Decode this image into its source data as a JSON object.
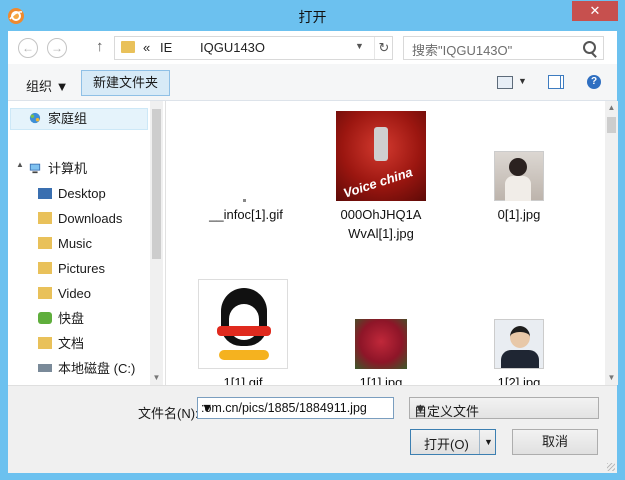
{
  "window": {
    "title": "打开",
    "close_glyph": "✕"
  },
  "nav": {
    "back_glyph": "←",
    "forward_glyph": "→",
    "up_glyph": "↑",
    "address_segments": [
      "«",
      "IE",
      "IQGU143O"
    ],
    "address_dropdown_glyph": "▼",
    "refresh_glyph": "↻",
    "search_placeholder": "搜索\"IQGU143O\""
  },
  "toolbar": {
    "organize_label": "组织 ▼",
    "new_folder_label": "新建文件夹",
    "views_dropdown_glyph": "▼",
    "help_glyph": "?"
  },
  "sidebar": {
    "items": [
      {
        "label": "家庭组",
        "icon": "homegroup-icon"
      },
      {
        "label": "计算机",
        "icon": "computer-icon"
      },
      {
        "label": "Desktop",
        "icon": "folder-icon"
      },
      {
        "label": "Downloads",
        "icon": "folder-icon"
      },
      {
        "label": "Music",
        "icon": "folder-icon"
      },
      {
        "label": "Pictures",
        "icon": "folder-icon"
      },
      {
        "label": "Video",
        "icon": "folder-icon"
      },
      {
        "label": "快盘",
        "icon": "kuaipan-icon"
      },
      {
        "label": "文档",
        "icon": "folder-icon"
      },
      {
        "label": "本地磁盘 (C:)",
        "icon": "drive-icon"
      }
    ],
    "expand_glyph": "▲"
  },
  "files": [
    {
      "name": "__infoc[1].gif"
    },
    {
      "name": "000OhJHQ1AWvAl[1].jpg",
      "name_line1": "000OhJHQ1A",
      "name_line2": "WvAl[1].jpg",
      "thumb_caption": "Voice china"
    },
    {
      "name": "0[1].jpg"
    },
    {
      "name": "1[1].gif"
    },
    {
      "name": "1[1].jpg"
    },
    {
      "name": "1[2].jpg"
    }
  ],
  "bottom": {
    "filename_label": "文件名(N):",
    "filename_value": ":om.cn/pics/1885/1884911.jpg",
    "filename_dropdown_glyph": "▼",
    "filetype_value": "自定义文件",
    "filetype_dropdown_glyph": "▼",
    "open_label": "打开(O)",
    "open_dropdown_glyph": "▼",
    "cancel_label": "取消"
  },
  "scrollbar": {
    "up_glyph": "▲",
    "down_glyph": "▼"
  },
  "colors": {
    "frame": "#6cc1ef",
    "close_button": "#c7504e",
    "accent_blue": "#3c7fb1"
  }
}
